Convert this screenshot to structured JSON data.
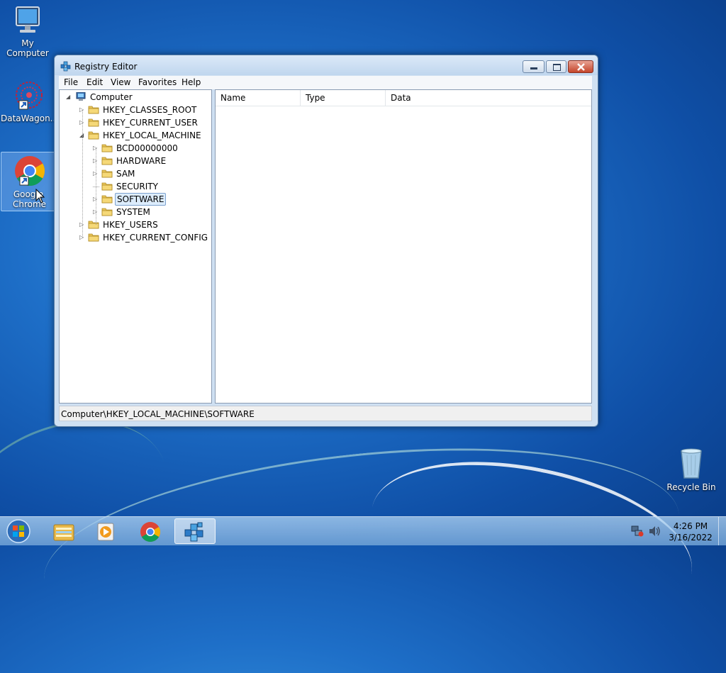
{
  "desktop": {
    "icons": [
      {
        "label": "My Computer"
      },
      {
        "label": "DataWagon..."
      },
      {
        "label": "Google Chrome"
      },
      {
        "label": "Recycle Bin"
      }
    ]
  },
  "window": {
    "title": "Registry Editor",
    "menu": [
      "File",
      "Edit",
      "View",
      "Favorites",
      "Help"
    ],
    "tree": {
      "root": "Computer",
      "hives": [
        "HKEY_CLASSES_ROOT",
        "HKEY_CURRENT_USER",
        "HKEY_LOCAL_MACHINE"
      ],
      "local_machine_children": [
        "BCD00000000",
        "HARDWARE",
        "SAM",
        "SECURITY",
        "SOFTWARE",
        "SYSTEM"
      ],
      "more_hives": [
        "HKEY_USERS",
        "HKEY_CURRENT_CONFIG"
      ],
      "selected": "SOFTWARE"
    },
    "columns": [
      "Name",
      "Type",
      "Data"
    ],
    "status": "Computer\\HKEY_LOCAL_MACHINE\\SOFTWARE"
  },
  "taskbar": {
    "time": "4:26 PM",
    "date": "3/16/2022"
  },
  "icons": {
    "start": "windows-orb-icon",
    "explorer": "folder-icon",
    "media": "media-player-icon",
    "chrome": "chrome-icon",
    "regedit": "registry-editor-icon"
  },
  "colors": {
    "accent": "#1e6fc8",
    "close": "#c4452a"
  }
}
